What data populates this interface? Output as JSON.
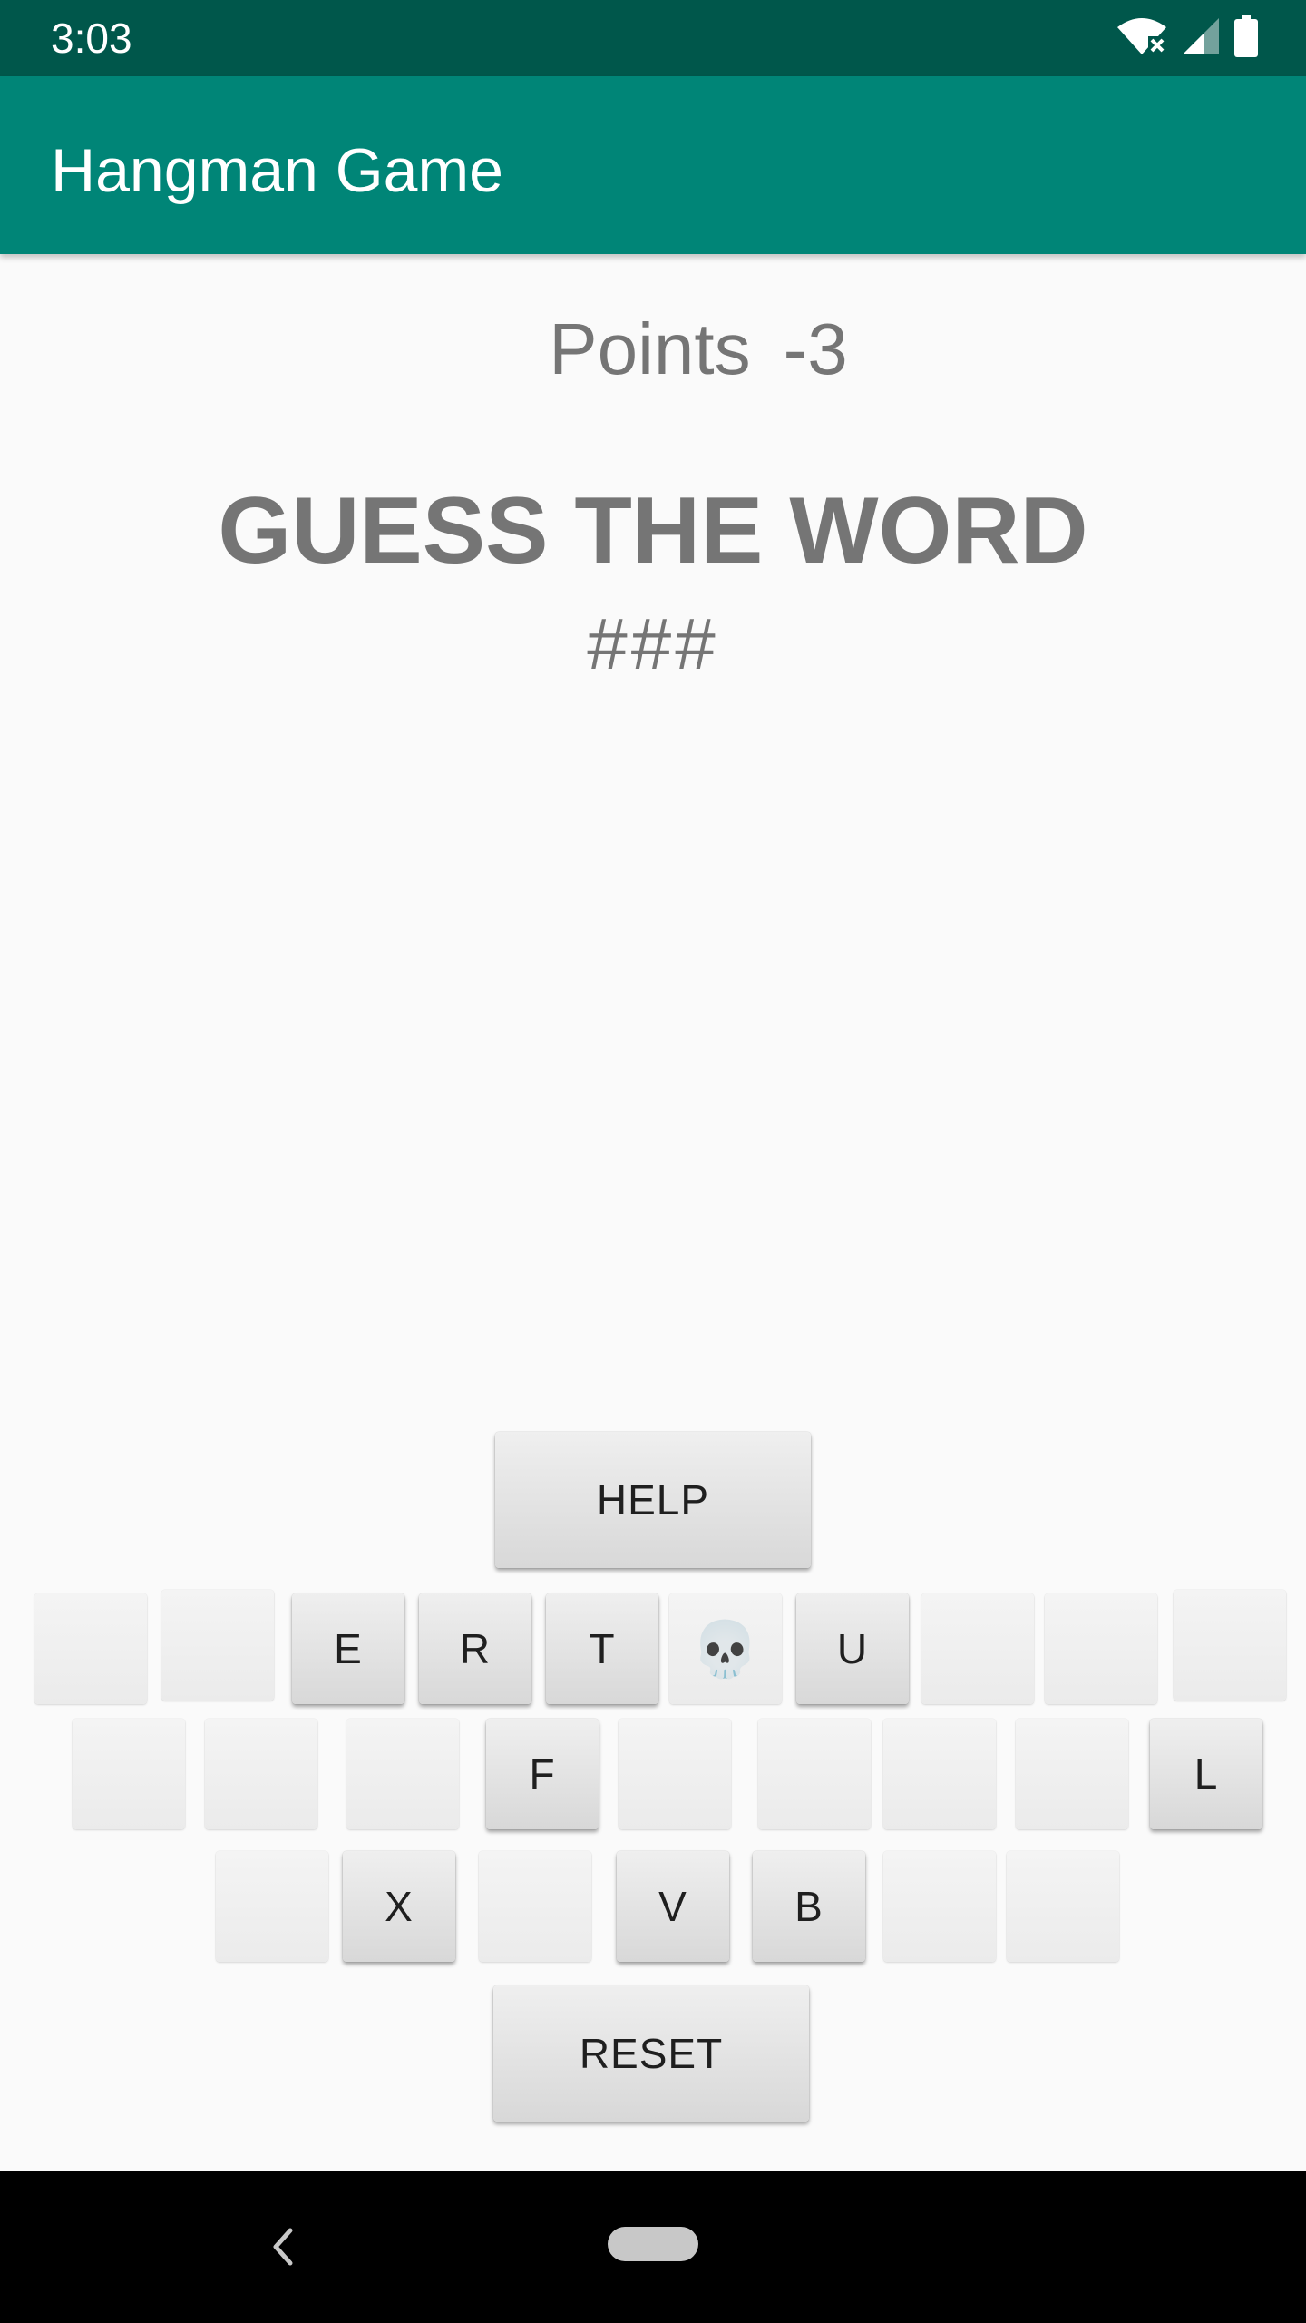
{
  "status_bar": {
    "time": "3:03",
    "icons": [
      "wifi-off-icon",
      "signal-icon",
      "battery-icon"
    ]
  },
  "app_bar": {
    "title": "Hangman Game"
  },
  "game": {
    "points_label": "Points",
    "points_value": "-3",
    "heading": "GUESS THE WORD",
    "masked_word": "###"
  },
  "buttons": {
    "help": "HELP",
    "reset": "RESET"
  },
  "keyboard": {
    "row1": [
      {
        "label": "",
        "state": "used"
      },
      {
        "label": "",
        "state": "used"
      },
      {
        "label": "E",
        "state": "active"
      },
      {
        "label": "R",
        "state": "active"
      },
      {
        "label": "T",
        "state": "active"
      },
      {
        "label": "💀",
        "state": "used"
      },
      {
        "label": "U",
        "state": "active"
      },
      {
        "label": "",
        "state": "used"
      },
      {
        "label": "",
        "state": "used"
      },
      {
        "label": "",
        "state": "used"
      }
    ],
    "row2": [
      {
        "label": "",
        "state": "used"
      },
      {
        "label": "",
        "state": "used"
      },
      {
        "label": "",
        "state": "used"
      },
      {
        "label": "F",
        "state": "active"
      },
      {
        "label": "",
        "state": "used"
      },
      {
        "label": "",
        "state": "used"
      },
      {
        "label": "",
        "state": "used"
      },
      {
        "label": "",
        "state": "used"
      },
      {
        "label": "L",
        "state": "active"
      }
    ],
    "row3": [
      {
        "label": "",
        "state": "used"
      },
      {
        "label": "X",
        "state": "active"
      },
      {
        "label": "",
        "state": "used"
      },
      {
        "label": "V",
        "state": "active"
      },
      {
        "label": "B",
        "state": "active"
      },
      {
        "label": "",
        "state": "used"
      },
      {
        "label": "",
        "state": "used"
      }
    ]
  },
  "nav_bar": {
    "icons": [
      "back-icon",
      "home-pill-icon"
    ]
  },
  "colors": {
    "status_bar": "#00574b",
    "app_bar": "#008577",
    "text_gray": "#757575",
    "background": "#fafafa"
  }
}
